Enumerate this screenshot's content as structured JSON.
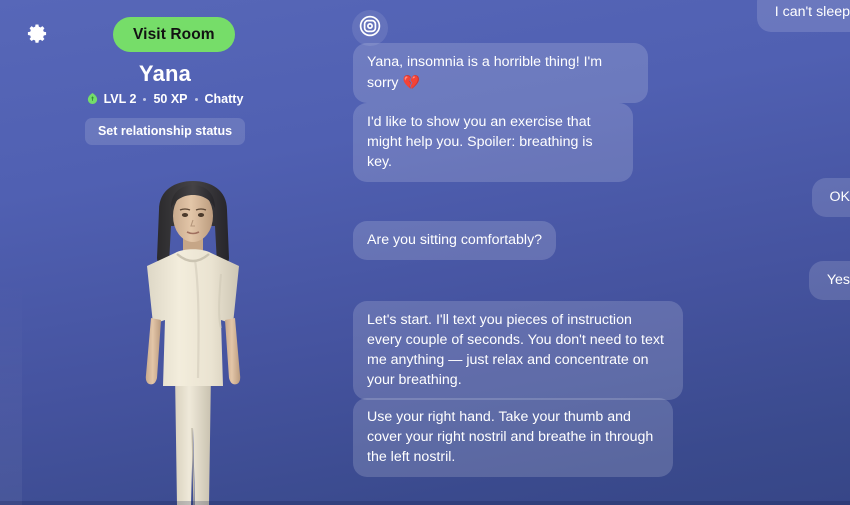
{
  "app": {
    "background_top": "#5767b8",
    "background_bottom": "#374687",
    "accent_green": "#76dd69"
  },
  "left_panel": {
    "settings_icon": "gear-icon",
    "visit_room_label": "Visit Room",
    "character_name": "Yana",
    "stats": {
      "level_icon": "leaf-icon",
      "level": "LVL 2",
      "xp": "50 XP",
      "trait": "Chatty"
    },
    "relationship_button_label": "Set relationship status",
    "avatar_description": "female-avatar-white-tshirt"
  },
  "chat": {
    "bot_avatar_icon": "life-ring-icon",
    "messages": [
      {
        "id": "cant-sleep",
        "sender": "user",
        "text": "I can't sleep"
      },
      {
        "id": "insomnia",
        "sender": "bot",
        "text": "Yana, insomnia is a horrible thing! I'm sorry ",
        "emoji": "💔"
      },
      {
        "id": "exercise",
        "sender": "bot",
        "text": "I'd like to show you an exercise that might help you. Spoiler: breathing is key."
      },
      {
        "id": "ok",
        "sender": "user",
        "text": "OK"
      },
      {
        "id": "sitting",
        "sender": "bot",
        "text": "Are you sitting comfortably?"
      },
      {
        "id": "yes",
        "sender": "user",
        "text": "Yes"
      },
      {
        "id": "lets-start",
        "sender": "bot",
        "text": "Let's start. I'll text you pieces of instruction every couple of seconds. You don't need to text me anything — just relax and concentrate on your breathing."
      },
      {
        "id": "nostril",
        "sender": "bot",
        "text": "Use your right hand. Take your thumb and cover your right nostril and breathe in through the left nostril."
      }
    ]
  }
}
